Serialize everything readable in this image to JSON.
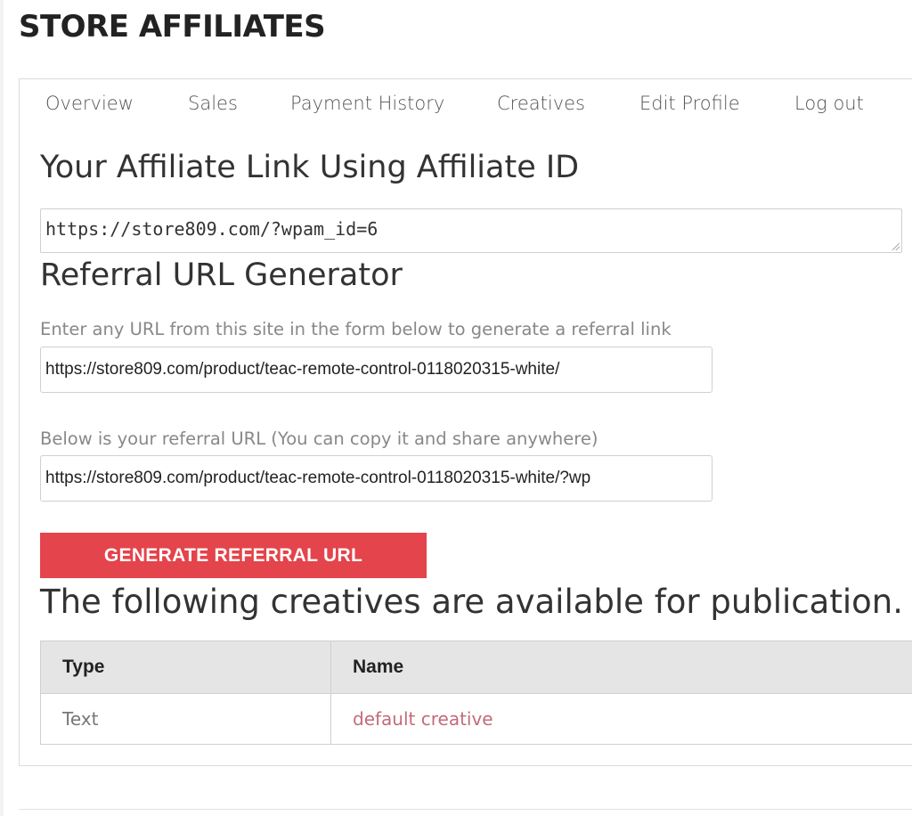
{
  "page": {
    "title": "STORE AFFILIATES"
  },
  "nav": {
    "items": [
      {
        "label": "Overview"
      },
      {
        "label": "Sales"
      },
      {
        "label": "Payment History"
      },
      {
        "label": "Creatives"
      },
      {
        "label": "Edit Profile"
      },
      {
        "label": "Log out"
      }
    ]
  },
  "affiliate_link": {
    "heading": "Your Affiliate Link Using Affiliate ID",
    "value": "https://store809.com/?wpam_id=6"
  },
  "referral_generator": {
    "heading": "Referral URL Generator",
    "input_label": "Enter any URL from this site in the form below to generate a referral link",
    "input_value": "https://store809.com/product/teac-remote-control-0118020315-white/",
    "output_label": "Below is your referral URL (You can copy it and share anywhere)",
    "output_value": "https://store809.com/product/teac-remote-control-0118020315-white/?wp",
    "button_label": "GENERATE REFERRAL URL"
  },
  "creatives": {
    "heading": "The following creatives are available for publication.",
    "columns": [
      "Type",
      "Name"
    ],
    "rows": [
      {
        "type": "Text",
        "name": "default creative"
      }
    ]
  },
  "colors": {
    "button_bg": "#e4444b",
    "link": "#c46b78",
    "header_bg": "#e5e5e5"
  }
}
